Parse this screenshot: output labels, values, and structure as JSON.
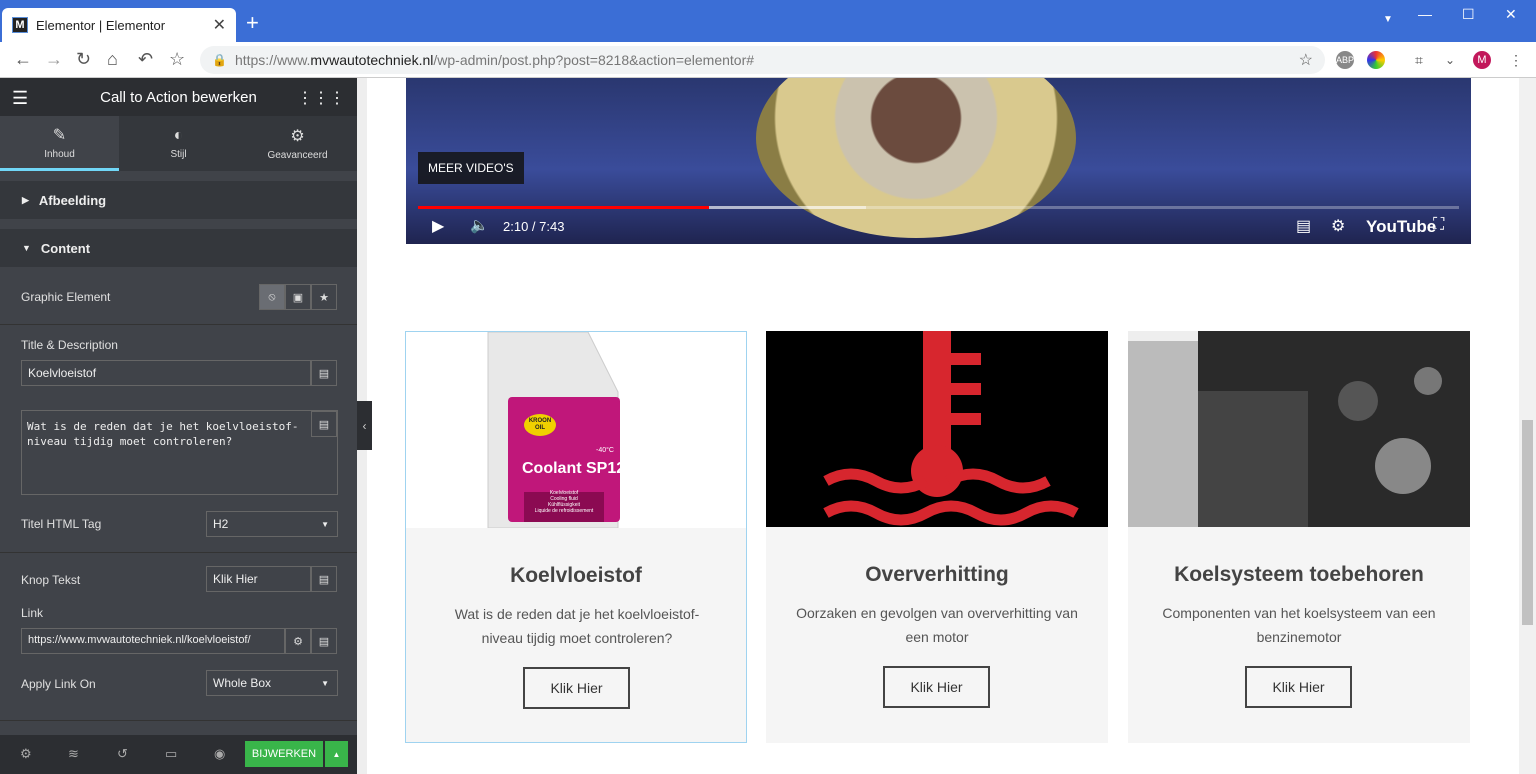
{
  "browser": {
    "tab_title": "Elementor | Elementor",
    "favicon_letter": "M",
    "url_prefix": "https://www.",
    "url_domain": "mvwautotechniek.nl",
    "url_path": "/wp-admin/post.php?post=8218&action=elementor#",
    "profile_initial": "M"
  },
  "panel": {
    "title": "Call to Action bewerken",
    "tabs": [
      {
        "label": "Inhoud",
        "icon": "pencil-icon"
      },
      {
        "label": "Stijl",
        "icon": "contrast-icon"
      },
      {
        "label": "Geavanceerd",
        "icon": "gear-icon"
      }
    ],
    "sections": {
      "afbeelding": "Afbeelding",
      "content": "Content"
    },
    "graphic_element_label": "Graphic Element",
    "title_desc_label": "Title & Description",
    "title_value": "Koelvloeistof",
    "description_value": "Wat is de reden dat je het koelvloeistof-niveau tijdig moet controleren?",
    "html_tag_label": "Titel HTML Tag",
    "html_tag_value": "H2",
    "button_text_label": "Knop Tekst",
    "button_text_value": "Klik Hier",
    "link_label": "Link",
    "link_value": "https://www.mvwautotechniek.nl/koelvloeistof/",
    "apply_link_label": "Apply Link On",
    "apply_link_value": "Whole Box",
    "update_label": "BIJWERKEN"
  },
  "video": {
    "more_videos": "MEER VIDEO'S",
    "time": "2:10 / 7:43",
    "youtube": "YouTube",
    "progress": 0.28,
    "buffered": 0.43
  },
  "cards": [
    {
      "title": "Koelvloeistof",
      "desc": "Wat is de reden dat je het koelvloeistof-niveau tijdig moet controleren?",
      "button": "Klik Hier",
      "label_brand": "KROON OIL",
      "label_product": "Coolant SP12",
      "label_temp": "-40°C",
      "label_lines": [
        "Koelvloeistof",
        "Cooling fluid",
        "Kühlflüssigkeit",
        "Liquide de refroidissement"
      ]
    },
    {
      "title": "Oververhitting",
      "desc": "Oorzaken en gevolgen van oververhitting van een motor",
      "button": "Klik Hier"
    },
    {
      "title": "Koelsysteem toebehoren",
      "desc": "Componenten van het koelsysteem van een benzinemotor",
      "button": "Klik Hier"
    }
  ]
}
